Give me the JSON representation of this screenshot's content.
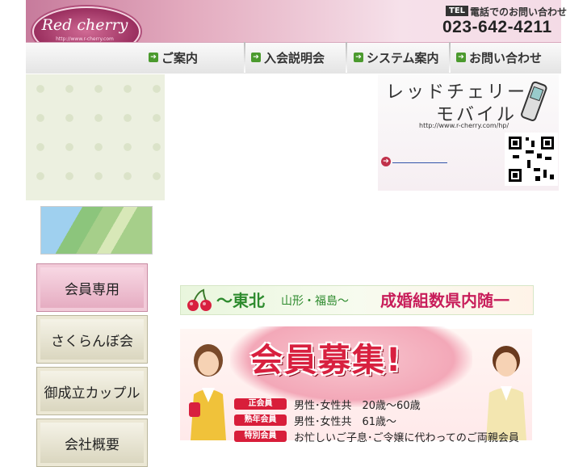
{
  "header": {
    "logo_text": "Red cherry",
    "logo_url": "http://www.r-cherry.com",
    "tel_badge": "TEL",
    "tel_label": "電話でのお問い合わせ",
    "tel_number": "023-642-4211"
  },
  "nav": {
    "items": [
      {
        "label": "ご案内"
      },
      {
        "label": "入会説明会"
      },
      {
        "label": "システム案内"
      },
      {
        "label": "お問い合わせ"
      }
    ]
  },
  "sidebar": {
    "buttons": [
      {
        "label": "会員専用"
      },
      {
        "label": "さくらんぼ会"
      },
      {
        "label": "御成立カップル"
      },
      {
        "label": "会社概要"
      }
    ]
  },
  "mobile_banner": {
    "title_line1": "レッドチェリー",
    "title_line2": "モバイル",
    "url": "http://www.r-cherry.com/hp/"
  },
  "tohoku_banner": {
    "text_main": "～東北",
    "text_sub": "山形・福島～",
    "text_right": "成婚組数県内随一"
  },
  "recruit_banner": {
    "title": "会員募集!",
    "rows": [
      {
        "badge": "正会員",
        "text": "男性･女性共　20歳～60歳"
      },
      {
        "badge": "熟年会員",
        "text": "男性･女性共　61歳～"
      },
      {
        "badge": "特別会員",
        "text": "お忙しいご子息･ご令嬢に代わってのご両親会員"
      }
    ]
  },
  "colors": {
    "brand_pink": "#b04f7a",
    "nav_arrow_green": "#4b9a2e",
    "recruit_red": "#d81e3a",
    "tohoku_green": "#2e8b2e"
  }
}
